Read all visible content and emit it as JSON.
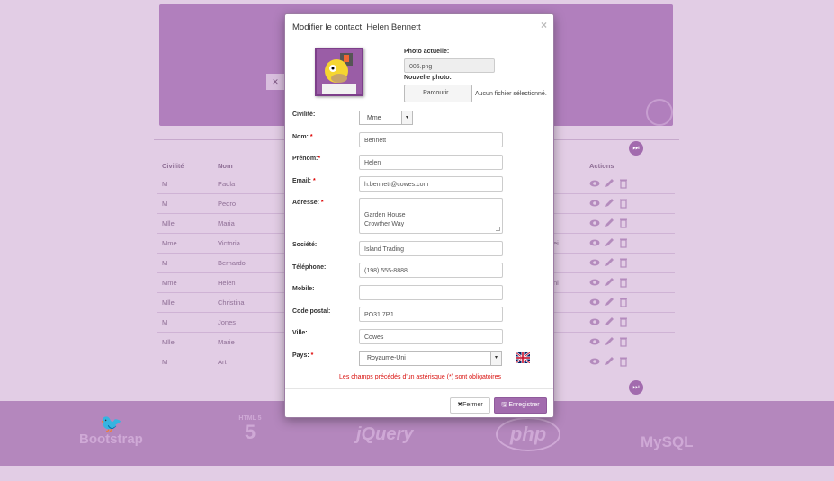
{
  "background": {
    "table_headers": {
      "civilite": "Civilité",
      "nom": "Nom",
      "actions": "Actions"
    },
    "rows": [
      {
        "civilite": "M",
        "nom": "Paola",
        "fragment": ""
      },
      {
        "civilite": "M",
        "nom": "Pedro",
        "fragment": ""
      },
      {
        "civilite": "Mlle",
        "nom": "Maria",
        "fragment": ""
      },
      {
        "civilite": "Mme",
        "nom": "Victoria",
        "fragment": "ei"
      },
      {
        "civilite": "M",
        "nom": "Bernardo",
        "fragment": ""
      },
      {
        "civilite": "Mme",
        "nom": "Helen",
        "fragment": "ni"
      },
      {
        "civilite": "Mlle",
        "nom": "Christina",
        "fragment": ""
      },
      {
        "civilite": "M",
        "nom": "Jones",
        "fragment": ""
      },
      {
        "civilite": "Mlle",
        "nom": "Marie",
        "fragment": ""
      },
      {
        "civilite": "M",
        "nom": "Art",
        "fragment": ""
      }
    ],
    "footer_logos": [
      "Bootstrap",
      "HTML 5",
      "jQuery",
      "php",
      "MySQL"
    ]
  },
  "modal": {
    "title": "Modifier le contact: Helen Bennett",
    "close_glyph": "×",
    "photo_actuelle_label": "Photo actuelle:",
    "photo_actuelle_value": "006.png",
    "nouvelle_photo_label": "Nouvelle photo:",
    "browse_button": "Parcourir...",
    "file_status": "Aucun fichier sélectionné.",
    "fields": {
      "civilite": {
        "label": "Civilité:",
        "value": "Mme"
      },
      "nom": {
        "label": "Nom:",
        "value": "Bennett"
      },
      "prenom": {
        "label": "Prénom:",
        "value": "Helen"
      },
      "email": {
        "label": "Email:",
        "value": "h.bennett@cowes.com"
      },
      "adresse": {
        "label": "Adresse:",
        "value": "Garden House\nCrowther Way"
      },
      "societe": {
        "label": "Société:",
        "value": "Island Trading"
      },
      "telephone": {
        "label": "Téléphone:",
        "value": "(198) 555-8888"
      },
      "mobile": {
        "label": "Mobile:",
        "value": ""
      },
      "code_postal": {
        "label": "Code postal:",
        "value": "PO31 7PJ"
      },
      "ville": {
        "label": "Ville:",
        "value": "Cowes"
      },
      "pays": {
        "label": "Pays:",
        "value": "Royaume-Uni"
      }
    },
    "required_marker": "*",
    "required_note": "Les champs précédés d'un astérisque (*) sont obligatoires",
    "fermer_button": "Fermer",
    "enregistrer_button": "Enregistrer"
  },
  "colors": {
    "accent": "#a26bae",
    "required": "#d9120f"
  }
}
